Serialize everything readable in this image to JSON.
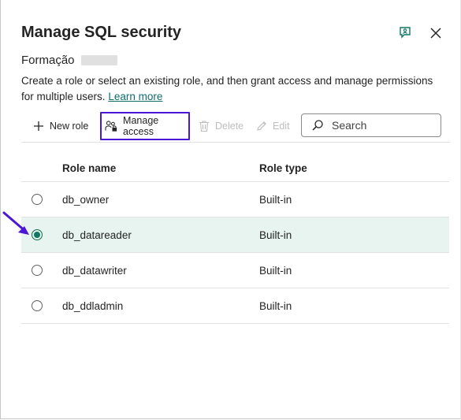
{
  "dialog": {
    "title": "Manage SQL security",
    "workspace_name": "Formação",
    "description": "Create a role or select an existing role, and then grant access and manage permissions for multiple users.",
    "learn_more": "Learn more"
  },
  "toolbar": {
    "new_role": "New role",
    "manage_access": "Manage access",
    "delete": "Delete",
    "edit": "Edit",
    "search_placeholder": "Search"
  },
  "table": {
    "columns": [
      "Role name",
      "Role type"
    ],
    "rows": [
      {
        "name": "db_owner",
        "type": "Built-in",
        "selected": false
      },
      {
        "name": "db_datareader",
        "type": "Built-in",
        "selected": true
      },
      {
        "name": "db_datawriter",
        "type": "Built-in",
        "selected": false
      },
      {
        "name": "db_ddladmin",
        "type": "Built-in",
        "selected": false
      }
    ]
  },
  "colors": {
    "accent": "#117865",
    "highlight_box": "#4b16d4",
    "selected_row": "#e7f4ef",
    "link": "#0f6c6c"
  },
  "icons": [
    "feedback-icon",
    "close-icon",
    "plus-icon",
    "people-lock-icon",
    "trash-icon",
    "pencil-icon",
    "search-icon",
    "pointer-arrow-icon"
  ]
}
